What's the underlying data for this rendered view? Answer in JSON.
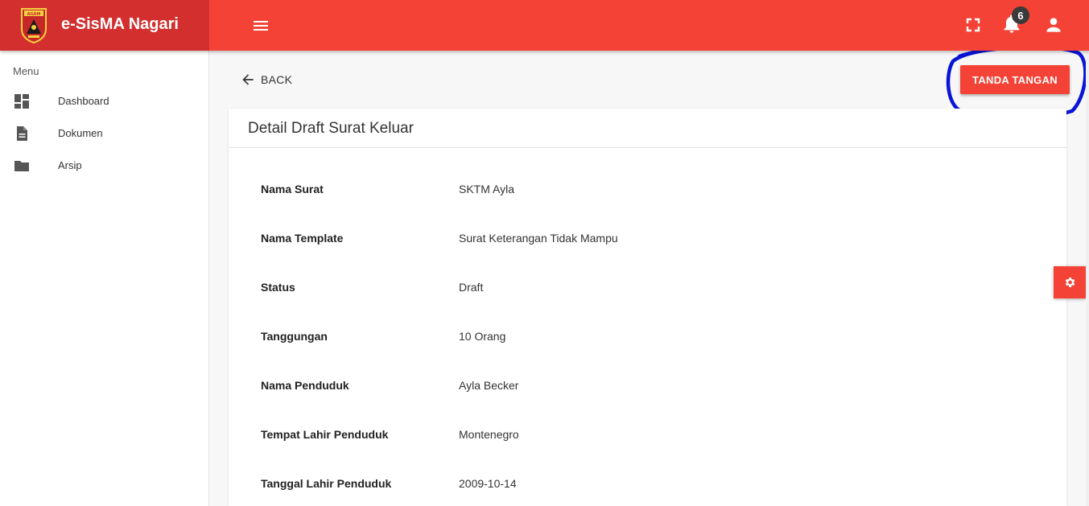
{
  "app": {
    "name": "e-SisMA Nagari"
  },
  "header": {
    "notification_count": "6",
    "icons": [
      "menu-icon",
      "fullscreen-icon",
      "bell-icon",
      "user-icon"
    ]
  },
  "sidebar": {
    "header": "Menu",
    "items": [
      {
        "label": "Dashboard",
        "icon": "dashboard-icon"
      },
      {
        "label": "Dokumen",
        "icon": "document-icon"
      },
      {
        "label": "Arsip",
        "icon": "folder-icon"
      }
    ]
  },
  "main": {
    "back_label": "BACK",
    "sign_button_label": "TANDA TANGAN",
    "card_title": "Detail Draft Surat Keluar",
    "fields": [
      {
        "label": "Nama Surat",
        "value": "SKTM Ayla"
      },
      {
        "label": "Nama Template",
        "value": "Surat Keterangan Tidak Mampu"
      },
      {
        "label": "Status",
        "value": "Draft"
      },
      {
        "label": "Tanggungan",
        "value": "10 Orang"
      },
      {
        "label": "Nama Penduduk",
        "value": "Ayla Becker"
      },
      {
        "label": "Tempat Lahir Penduduk",
        "value": "Montenegro"
      },
      {
        "label": "Tanggal Lahir Penduduk",
        "value": "2009-10-14"
      }
    ]
  },
  "colors": {
    "primary": "#f44336",
    "brand_dark": "#d32f2f",
    "annotation": "#0a14d8"
  }
}
